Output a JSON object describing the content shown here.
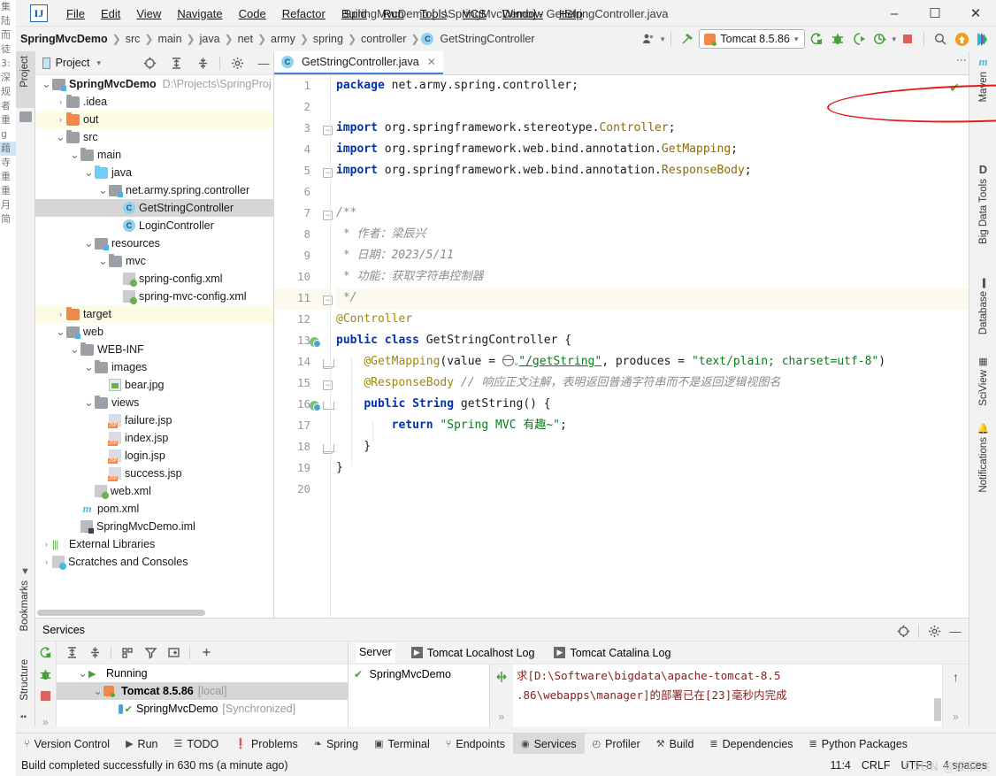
{
  "window": {
    "title": "SpringMvcDemo [...\\SpringMvcDemo] - GetStringController.java",
    "minimize": "–",
    "maximize": "☐",
    "close": "✕",
    "logo": "IJ"
  },
  "menu": [
    "File",
    "Edit",
    "View",
    "Navigate",
    "Code",
    "Refactor",
    "Build",
    "Run",
    "Tools",
    "VCS",
    "Window",
    "Help"
  ],
  "breadcrumb": {
    "items": [
      "SpringMvcDemo",
      "src",
      "main",
      "java",
      "net",
      "army",
      "spring",
      "controller"
    ],
    "current": "GetStringController",
    "class_badge": "C"
  },
  "toolbar": {
    "run_config": "Tomcat 8.5.86",
    "icons": [
      "user-group-icon",
      "hammer-icon",
      "run-icon",
      "debug-icon",
      "run-with-coverage-icon",
      "profile-icon",
      "stop-icon",
      "search-icon",
      "update-icon",
      "ide-assistant-icon"
    ]
  },
  "left_strip": {
    "project": "Project",
    "bookmarks": "Bookmarks",
    "structure": "Structure"
  },
  "right_strip": [
    "Maven",
    "Big Data Tools",
    "Database",
    "SciView",
    "Notifications"
  ],
  "project_panel": {
    "title": "Project",
    "tree": [
      {
        "indent": 0,
        "arrow": "v",
        "icon": "module-icon",
        "label": "SpringMvcDemo",
        "bold": true,
        "path": "D:\\Projects\\SpringProj",
        "state": "normal"
      },
      {
        "indent": 1,
        "arrow": ">",
        "icon": "folder-gray",
        "label": ".idea",
        "state": "normal"
      },
      {
        "indent": 1,
        "arrow": ">",
        "icon": "folder-orange",
        "label": "out",
        "state": "dim"
      },
      {
        "indent": 1,
        "arrow": "v",
        "icon": "folder-gray",
        "label": "src",
        "state": "normal"
      },
      {
        "indent": 2,
        "arrow": "v",
        "icon": "folder-gray",
        "label": "main",
        "state": "normal"
      },
      {
        "indent": 3,
        "arrow": "v",
        "icon": "folder-blue",
        "label": "java",
        "state": "normal"
      },
      {
        "indent": 4,
        "arrow": "v",
        "icon": "package-icon",
        "label": "net.army.spring.controller",
        "state": "normal"
      },
      {
        "indent": 5,
        "arrow": "",
        "icon": "class-icon",
        "label": "GetStringController",
        "state": "selected"
      },
      {
        "indent": 5,
        "arrow": "",
        "icon": "class-icon",
        "label": "LoginController",
        "state": "normal"
      },
      {
        "indent": 3,
        "arrow": "v",
        "icon": "resources-icon",
        "label": "resources",
        "state": "normal"
      },
      {
        "indent": 4,
        "arrow": "v",
        "icon": "folder-gray",
        "label": "mvc",
        "state": "normal"
      },
      {
        "indent": 5,
        "arrow": "",
        "icon": "xml-spring-icon",
        "label": "spring-config.xml",
        "state": "normal"
      },
      {
        "indent": 5,
        "arrow": "",
        "icon": "xml-spring-icon",
        "label": "spring-mvc-config.xml",
        "state": "normal"
      },
      {
        "indent": 1,
        "arrow": ">",
        "icon": "folder-orange",
        "label": "target",
        "state": "dim"
      },
      {
        "indent": 1,
        "arrow": "v",
        "icon": "web-icon",
        "label": "web",
        "state": "normal"
      },
      {
        "indent": 2,
        "arrow": "v",
        "icon": "folder-gray",
        "label": "WEB-INF",
        "state": "normal"
      },
      {
        "indent": 3,
        "arrow": "v",
        "icon": "folder-gray",
        "label": "images",
        "state": "normal"
      },
      {
        "indent": 4,
        "arrow": "",
        "icon": "image-icon",
        "label": "bear.jpg",
        "state": "normal"
      },
      {
        "indent": 3,
        "arrow": "v",
        "icon": "folder-gray",
        "label": "views",
        "state": "normal"
      },
      {
        "indent": 4,
        "arrow": "",
        "icon": "jsp-icon",
        "label": "failure.jsp",
        "state": "normal"
      },
      {
        "indent": 4,
        "arrow": "",
        "icon": "jsp-icon",
        "label": "index.jsp",
        "state": "normal"
      },
      {
        "indent": 4,
        "arrow": "",
        "icon": "jsp-icon",
        "label": "login.jsp",
        "state": "normal"
      },
      {
        "indent": 4,
        "arrow": "",
        "icon": "jsp-icon",
        "label": "success.jsp",
        "state": "normal"
      },
      {
        "indent": 3,
        "arrow": "",
        "icon": "xml-spring-icon",
        "label": "web.xml",
        "state": "normal"
      },
      {
        "indent": 2,
        "arrow": "",
        "icon": "maven-icon",
        "label": "pom.xml",
        "state": "normal"
      },
      {
        "indent": 2,
        "arrow": "",
        "icon": "iml-icon",
        "label": "SpringMvcDemo.iml",
        "state": "normal"
      },
      {
        "indent": 0,
        "arrow": ">",
        "icon": "library-icon",
        "label": "External Libraries",
        "state": "normal"
      },
      {
        "indent": 0,
        "arrow": ">",
        "icon": "scratches-icon",
        "label": "Scratches and Consoles",
        "state": "normal"
      }
    ]
  },
  "editor": {
    "tab": "GetStringController.java",
    "tab_badge": "C",
    "tab_close": "✕",
    "inspection_status": "✔",
    "line_numbers": [
      "1",
      "2",
      "3",
      "4",
      "5",
      "6",
      "7",
      "8",
      "9",
      "10",
      "11",
      "12",
      "13",
      "14",
      "15",
      "16",
      "17",
      "18",
      "19",
      "20"
    ],
    "lines": [
      {
        "n": 1,
        "segments": [
          {
            "t": "package ",
            "c": "kw"
          },
          {
            "t": "net.army.spring.controller;",
            "c": "pln"
          }
        ]
      },
      {
        "n": 2,
        "segments": []
      },
      {
        "n": 3,
        "segments": [
          {
            "t": "import ",
            "c": "kw"
          },
          {
            "t": "org.springframework.stereotype.",
            "c": "pln"
          },
          {
            "t": "Controller",
            "c": "typ"
          },
          {
            "t": ";",
            "c": "pln"
          }
        ]
      },
      {
        "n": 4,
        "segments": [
          {
            "t": "import ",
            "c": "kw"
          },
          {
            "t": "org.springframework.web.bind.annotation.",
            "c": "pln"
          },
          {
            "t": "GetMapping",
            "c": "typ"
          },
          {
            "t": ";",
            "c": "pln"
          }
        ]
      },
      {
        "n": 5,
        "segments": [
          {
            "t": "import ",
            "c": "kw"
          },
          {
            "t": "org.springframework.web.bind.annotation.",
            "c": "pln"
          },
          {
            "t": "ResponseBody",
            "c": "typ"
          },
          {
            "t": ";",
            "c": "pln"
          }
        ]
      },
      {
        "n": 6,
        "segments": []
      },
      {
        "n": 7,
        "segments": [
          {
            "t": "/**",
            "c": "cmt"
          }
        ]
      },
      {
        "n": 8,
        "segments": [
          {
            "t": " * 作者：梁辰兴",
            "c": "cmt"
          }
        ]
      },
      {
        "n": 9,
        "segments": [
          {
            "t": " * 日期：2023/5/11",
            "c": "cmt"
          }
        ]
      },
      {
        "n": 10,
        "segments": [
          {
            "t": " * 功能：获取字符串控制器",
            "c": "cmt"
          }
        ]
      },
      {
        "n": 11,
        "segments": [
          {
            "t": " */",
            "c": "cmt"
          }
        ]
      },
      {
        "n": 12,
        "segments": [
          {
            "t": "@Controller",
            "c": "ann"
          }
        ]
      },
      {
        "n": 13,
        "segments": [
          {
            "t": "public class ",
            "c": "kw"
          },
          {
            "t": "GetStringController {",
            "c": "pln"
          }
        ]
      },
      {
        "n": 14,
        "segments": [
          {
            "t": "    ",
            "c": "pln"
          },
          {
            "t": "@GetMapping",
            "c": "ann"
          },
          {
            "t": "(value = ",
            "c": "pln"
          },
          {
            "t": "GLOBE",
            "c": "icon"
          },
          {
            "t": "\"/getString\"",
            "c": "lnk"
          },
          {
            "t": ", produces = ",
            "c": "pln"
          },
          {
            "t": "\"text/plain; charset=utf-8\"",
            "c": "str"
          },
          {
            "t": ")",
            "c": "pln"
          }
        ]
      },
      {
        "n": 15,
        "segments": [
          {
            "t": "    ",
            "c": "pln"
          },
          {
            "t": "@ResponseBody",
            "c": "ann"
          },
          {
            "t": " // 响应正文注解，表明返回普通字符串而不是返回逻辑视图名",
            "c": "cmt"
          }
        ]
      },
      {
        "n": 16,
        "segments": [
          {
            "t": "    ",
            "c": "pln"
          },
          {
            "t": "public String ",
            "c": "kw"
          },
          {
            "t": "getString() {",
            "c": "pln"
          }
        ]
      },
      {
        "n": 17,
        "segments": [
          {
            "t": "        ",
            "c": "pln"
          },
          {
            "t": "return ",
            "c": "kw"
          },
          {
            "t": "\"Spring MVC 有趣~\"",
            "c": "str"
          },
          {
            "t": ";",
            "c": "pln"
          }
        ]
      },
      {
        "n": 18,
        "segments": [
          {
            "t": "    }",
            "c": "pln"
          }
        ]
      },
      {
        "n": 19,
        "segments": [
          {
            "t": "}",
            "c": "pln"
          }
        ]
      },
      {
        "n": 20,
        "segments": []
      }
    ]
  },
  "services": {
    "title": "Services",
    "tree": [
      {
        "indent": 1,
        "arrow": "v",
        "icon": "run-triangle-icon",
        "label": "Running",
        "suffix": "",
        "bold": false,
        "state": "normal"
      },
      {
        "indent": 2,
        "arrow": "v",
        "icon": "tomcat-icon",
        "label": "Tomcat 8.5.86",
        "suffix": "[local]",
        "bold": true,
        "state": "selected"
      },
      {
        "indent": 3,
        "arrow": "",
        "icon": "artifact-check-icon",
        "label": "SpringMvcDemo",
        "suffix": "[Synchronized]",
        "bold": false,
        "state": "normal"
      }
    ],
    "tabs": [
      {
        "label": "Server",
        "icon": "",
        "active": true
      },
      {
        "label": "Tomcat Localhost Log",
        "icon": "console-icon",
        "active": false
      },
      {
        "label": "Tomcat Catalina Log",
        "icon": "console-icon",
        "active": false
      }
    ],
    "app_list": [
      {
        "label": "SpringMvcDemo",
        "status": "✔"
      }
    ],
    "log_lines": [
      "求[D:\\Software\\bigdata\\apache-tomcat-8.5",
      ".86\\webapps\\manager]的部署已在[23]毫秒内完成"
    ],
    "scroll_up": "↑",
    "expand": "»"
  },
  "bottom_tools": [
    {
      "label": "Version Control",
      "icon": "branch-icon",
      "active": false
    },
    {
      "label": "Run",
      "icon": "run-icon",
      "active": false
    },
    {
      "label": "TODO",
      "icon": "list-icon",
      "active": false
    },
    {
      "label": "Problems",
      "icon": "warning-icon",
      "active": false
    },
    {
      "label": "Spring",
      "icon": "leaf-icon",
      "active": false
    },
    {
      "label": "Terminal",
      "icon": "terminal-icon",
      "active": false
    },
    {
      "label": "Endpoints",
      "icon": "endpoints-icon",
      "active": false
    },
    {
      "label": "Services",
      "icon": "services-icon",
      "active": true
    },
    {
      "label": "Profiler",
      "icon": "profiler-icon",
      "active": false
    },
    {
      "label": "Build",
      "icon": "hammer-icon",
      "active": false
    },
    {
      "label": "Dependencies",
      "icon": "layers-icon",
      "active": false
    },
    {
      "label": "Python Packages",
      "icon": "layers-icon",
      "active": false
    }
  ],
  "status": {
    "message": "Build completed successfully in 630 ms (a minute ago)",
    "caret": "11:4",
    "line_sep": "CRLF",
    "encoding": "UTF-8",
    "indent": "4 spaces",
    "watermark": "CSDN @梁辰兴"
  },
  "background_window": {
    "lines": [
      "集",
      "陆",
      "而",
      "徒",
      "3:",
      "深",
      "规",
      "者",
      "重",
      "g",
      "",
      "藉",
      "",
      "",
      "寺",
      "",
      "",
      "",
      "重",
      "",
      "重",
      "",
      "月",
      "简"
    ]
  }
}
